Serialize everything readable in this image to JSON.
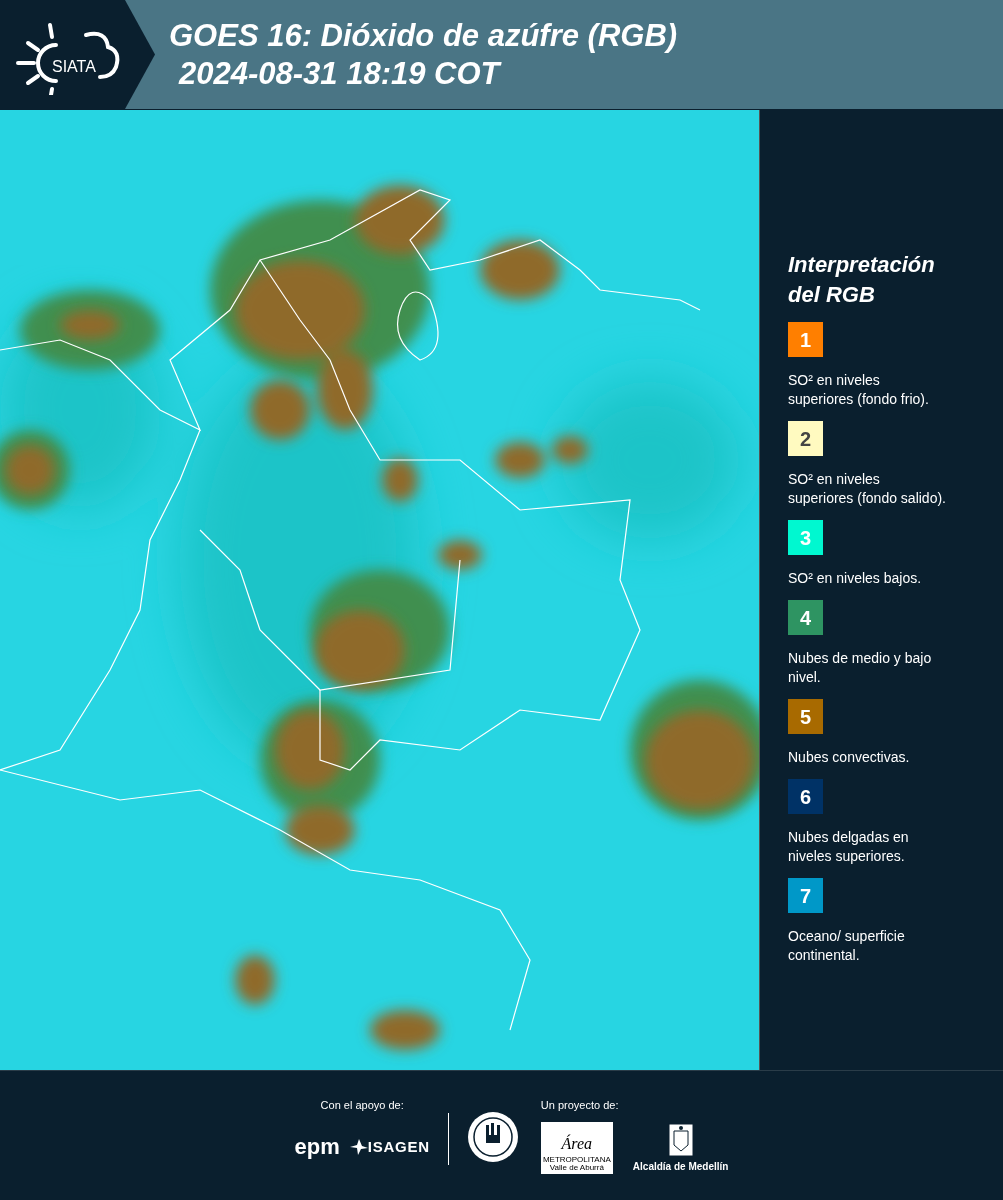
{
  "header": {
    "logo_text": "SIATA",
    "title": "GOES 16: Dióxido de azúfre (RGB)",
    "timestamp": "2024-08-31 18:19 COT"
  },
  "legend": {
    "title": "Interpretación del RGB",
    "items": [
      {
        "number": "1",
        "color": "#ff7f00",
        "text": "SO² en niveles superiores (fondo frio)."
      },
      {
        "number": "2",
        "color": "#fffac0",
        "text": "SO² en niveles superiores (fondo salido)."
      },
      {
        "number": "3",
        "color": "#00f8d0",
        "text": "SO² en niveles bajos."
      },
      {
        "number": "4",
        "color": "#2e9462",
        "text": "Nubes de medio y bajo nivel."
      },
      {
        "number": "5",
        "color": "#a86a00",
        "text": "Nubes convectivas."
      },
      {
        "number": "6",
        "color": "#003266",
        "text": "Nubes delgadas en niveles superiores."
      },
      {
        "number": "7",
        "color": "#0098c8",
        "text": "Oceano/ superficie continental."
      }
    ]
  },
  "footer": {
    "support_label": "Con el apoyo de:",
    "project_label": "Un proyecto de:",
    "epm": "epm",
    "isagen": "ISAGEN",
    "area_script": "Área",
    "area_line1": "METROPOLITANA",
    "area_line2": "Valle de Aburrá",
    "alcaldia": "Alcaldía de Medellín"
  }
}
